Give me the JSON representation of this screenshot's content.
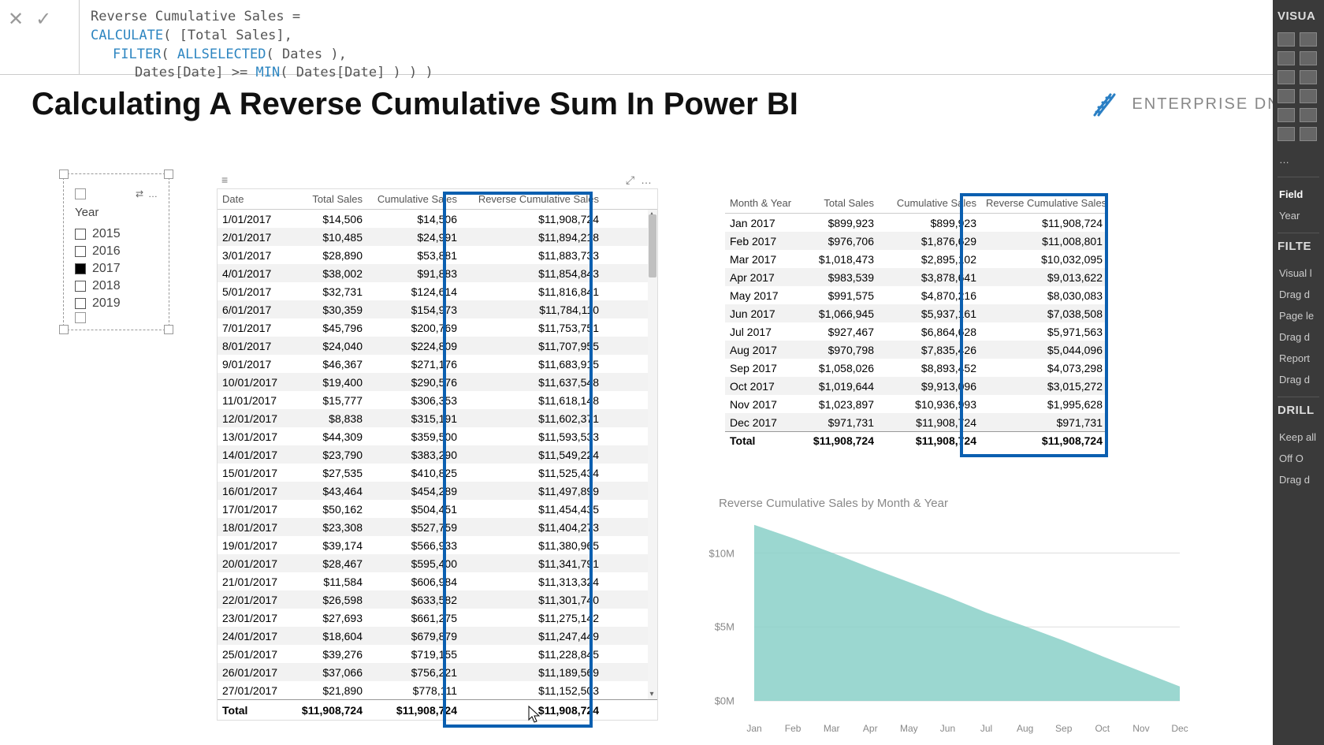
{
  "formula": {
    "line1_name": "Reverse Cumulative Sales",
    "eq": "=",
    "l2_a": "CALCULATE",
    "l2_b": "( [Total Sales],",
    "l3_a": "FILTER",
    "l3_b": "( ",
    "l3_c": "ALLSELECTED",
    "l3_d": "( Dates ),",
    "l4_a": "Dates[Date] >= ",
    "l4_b": "MIN",
    "l4_c": "( Dates[Date] ) ) )"
  },
  "title": "Calculating A Reverse Cumulative Sum In Power BI",
  "brand": "ENTERPRISE DNA",
  "slicer": {
    "label": "Year",
    "items": [
      {
        "label": "2015",
        "checked": false
      },
      {
        "label": "2016",
        "checked": false
      },
      {
        "label": "2017",
        "checked": true
      },
      {
        "label": "2018",
        "checked": false
      },
      {
        "label": "2019",
        "checked": false
      }
    ],
    "header_icon": "⇄",
    "header_dots": "…"
  },
  "daily": {
    "headers": [
      "Date",
      "Total Sales",
      "Cumulative Sales",
      "Reverse Cumulative Sales"
    ],
    "rows": [
      [
        "1/01/2017",
        "$14,506",
        "$14,506",
        "$11,908,724"
      ],
      [
        "2/01/2017",
        "$10,485",
        "$24,991",
        "$11,894,218"
      ],
      [
        "3/01/2017",
        "$28,890",
        "$53,881",
        "$11,883,733"
      ],
      [
        "4/01/2017",
        "$38,002",
        "$91,883",
        "$11,854,843"
      ],
      [
        "5/01/2017",
        "$32,731",
        "$124,614",
        "$11,816,841"
      ],
      [
        "6/01/2017",
        "$30,359",
        "$154,973",
        "$11,784,110"
      ],
      [
        "7/01/2017",
        "$45,796",
        "$200,769",
        "$11,753,751"
      ],
      [
        "8/01/2017",
        "$24,040",
        "$224,809",
        "$11,707,955"
      ],
      [
        "9/01/2017",
        "$46,367",
        "$271,176",
        "$11,683,915"
      ],
      [
        "10/01/2017",
        "$19,400",
        "$290,576",
        "$11,637,548"
      ],
      [
        "11/01/2017",
        "$15,777",
        "$306,353",
        "$11,618,148"
      ],
      [
        "12/01/2017",
        "$8,838",
        "$315,191",
        "$11,602,371"
      ],
      [
        "13/01/2017",
        "$44,309",
        "$359,500",
        "$11,593,533"
      ],
      [
        "14/01/2017",
        "$23,790",
        "$383,290",
        "$11,549,224"
      ],
      [
        "15/01/2017",
        "$27,535",
        "$410,825",
        "$11,525,434"
      ],
      [
        "16/01/2017",
        "$43,464",
        "$454,289",
        "$11,497,899"
      ],
      [
        "17/01/2017",
        "$50,162",
        "$504,451",
        "$11,454,435"
      ],
      [
        "18/01/2017",
        "$23,308",
        "$527,759",
        "$11,404,273"
      ],
      [
        "19/01/2017",
        "$39,174",
        "$566,933",
        "$11,380,965"
      ],
      [
        "20/01/2017",
        "$28,467",
        "$595,400",
        "$11,341,791"
      ],
      [
        "21/01/2017",
        "$11,584",
        "$606,984",
        "$11,313,324"
      ],
      [
        "22/01/2017",
        "$26,598",
        "$633,582",
        "$11,301,740"
      ],
      [
        "23/01/2017",
        "$27,693",
        "$661,275",
        "$11,275,142"
      ],
      [
        "24/01/2017",
        "$18,604",
        "$679,879",
        "$11,247,449"
      ],
      [
        "25/01/2017",
        "$39,276",
        "$719,155",
        "$11,228,845"
      ],
      [
        "26/01/2017",
        "$37,066",
        "$756,221",
        "$11,189,569"
      ],
      [
        "27/01/2017",
        "$21,890",
        "$778,111",
        "$11,152,503"
      ]
    ],
    "total": [
      "Total",
      "$11,908,724",
      "$11,908,724",
      "$11,908,724"
    ]
  },
  "monthly": {
    "headers": [
      "Month & Year",
      "Total Sales",
      "Cumulative Sales",
      "Reverse Cumulative Sales"
    ],
    "rows": [
      [
        "Jan 2017",
        "$899,923",
        "$899,923",
        "$11,908,724"
      ],
      [
        "Feb 2017",
        "$976,706",
        "$1,876,629",
        "$11,008,801"
      ],
      [
        "Mar 2017",
        "$1,018,473",
        "$2,895,102",
        "$10,032,095"
      ],
      [
        "Apr 2017",
        "$983,539",
        "$3,878,641",
        "$9,013,622"
      ],
      [
        "May 2017",
        "$991,575",
        "$4,870,216",
        "$8,030,083"
      ],
      [
        "Jun 2017",
        "$1,066,945",
        "$5,937,161",
        "$7,038,508"
      ],
      [
        "Jul 2017",
        "$927,467",
        "$6,864,628",
        "$5,971,563"
      ],
      [
        "Aug 2017",
        "$970,798",
        "$7,835,426",
        "$5,044,096"
      ],
      [
        "Sep 2017",
        "$1,058,026",
        "$8,893,452",
        "$4,073,298"
      ],
      [
        "Oct 2017",
        "$1,019,644",
        "$9,913,096",
        "$3,015,272"
      ],
      [
        "Nov 2017",
        "$1,023,897",
        "$10,936,993",
        "$1,995,628"
      ],
      [
        "Dec 2017",
        "$971,731",
        "$11,908,724",
        "$971,731"
      ]
    ],
    "total": [
      "Total",
      "$11,908,724",
      "$11,908,724",
      "$11,908,724"
    ]
  },
  "chart_title": "Reverse Cumulative Sales by Month & Year",
  "chart_data": {
    "type": "area",
    "title": "Reverse Cumulative Sales by Month & Year",
    "xlabel": "",
    "ylabel": "",
    "categories": [
      "Jan",
      "Feb",
      "Mar",
      "Apr",
      "May",
      "Jun",
      "Jul",
      "Aug",
      "Sep",
      "Oct",
      "Nov",
      "Dec"
    ],
    "values": [
      11908724,
      11008801,
      10032095,
      9013622,
      8030083,
      7038508,
      5971563,
      5044096,
      4073298,
      3015272,
      1995628,
      971731
    ],
    "ylim": [
      0,
      12000000
    ],
    "yticks": [
      {
        "v": 0,
        "label": "$0M"
      },
      {
        "v": 5000000,
        "label": "$5M"
      },
      {
        "v": 10000000,
        "label": "$10M"
      }
    ],
    "color": "#89d0c8"
  },
  "right": {
    "hdr1": "VISUA",
    "dots": "…",
    "field": "Field",
    "year": "Year",
    "filter": "FILTE",
    "vis": "Visual l",
    "drag": "Drag d",
    "pagel": "Page le",
    "report": "Report",
    "drill": "DRILL",
    "keep": "Keep all",
    "off": "Off   O",
    "drag2": "Drag d"
  }
}
